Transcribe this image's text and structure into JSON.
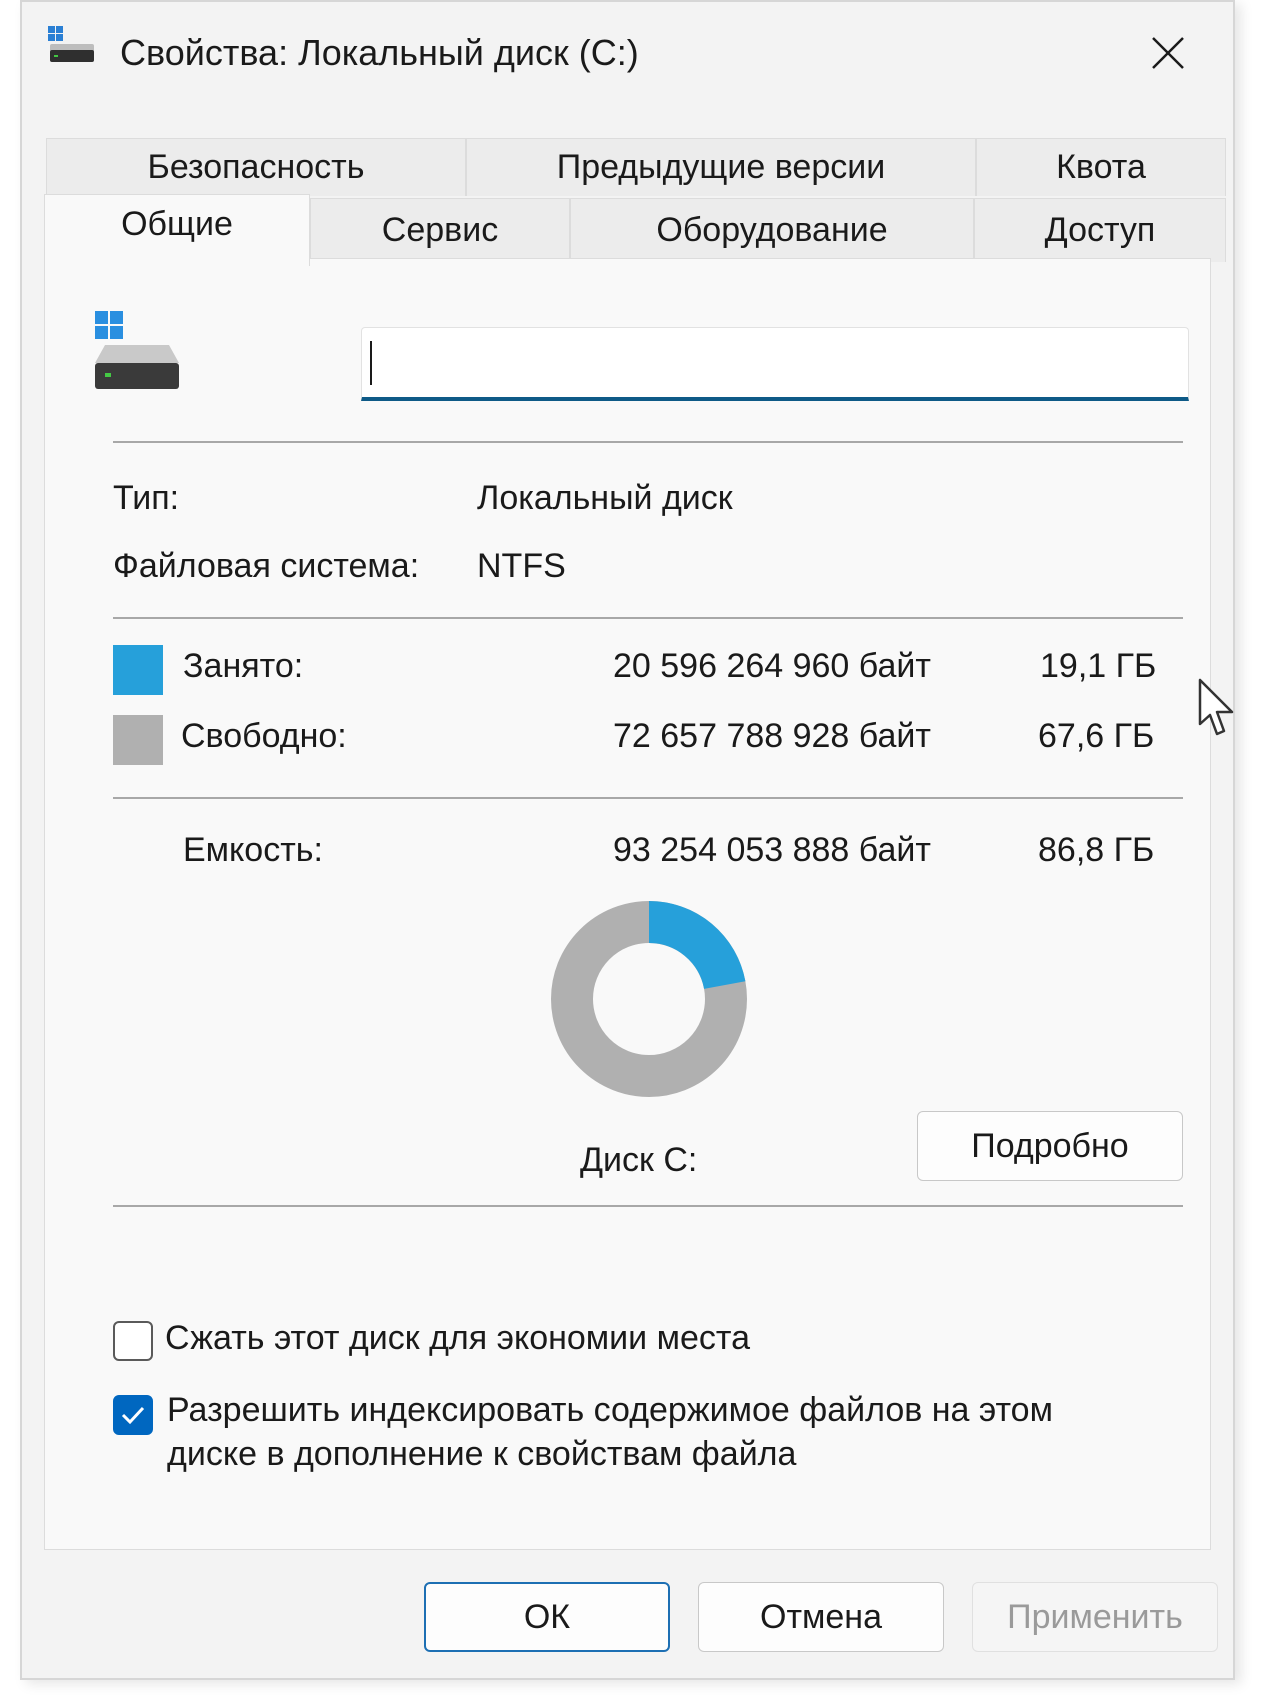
{
  "window": {
    "title": "Свойства: Локальный диск (C:)"
  },
  "tabs": {
    "back_row": [
      {
        "label": "Безопасность"
      },
      {
        "label": "Предыдущие версии"
      },
      {
        "label": "Квота"
      }
    ],
    "front_row": [
      {
        "label": "Общие",
        "active": true
      },
      {
        "label": "Сервис"
      },
      {
        "label": "Оборудование"
      },
      {
        "label": "Доступ"
      }
    ]
  },
  "general": {
    "name_value": "",
    "type_label": "Тип:",
    "type_value": "Локальный диск",
    "fs_label": "Файловая система:",
    "fs_value": "NTFS",
    "used": {
      "label": "Занято:",
      "bytes": "20 596 264 960 байт",
      "size": "19,1 ГБ",
      "color": "#26a0da"
    },
    "free": {
      "label": "Свободно:",
      "bytes": "72 657 788 928 байт",
      "size": "67,6 ГБ",
      "color": "#b0b0b0"
    },
    "capacity": {
      "label": "Емкость:",
      "bytes": "93 254 053 888 байт",
      "size": "86,8 ГБ"
    },
    "usage_fraction": 0.221,
    "disk_label": "Диск C:",
    "details_button": "Подробно",
    "compress_label": "Сжать этот диск для экономии места",
    "compress_checked": false,
    "index_label_line1": "Разрешить индексировать содержимое файлов на этом",
    "index_label_line2": "диске в дополнение к свойствам файла",
    "index_checked": true
  },
  "footer": {
    "ok": "ОК",
    "cancel": "Отмена",
    "apply": "Применить"
  }
}
